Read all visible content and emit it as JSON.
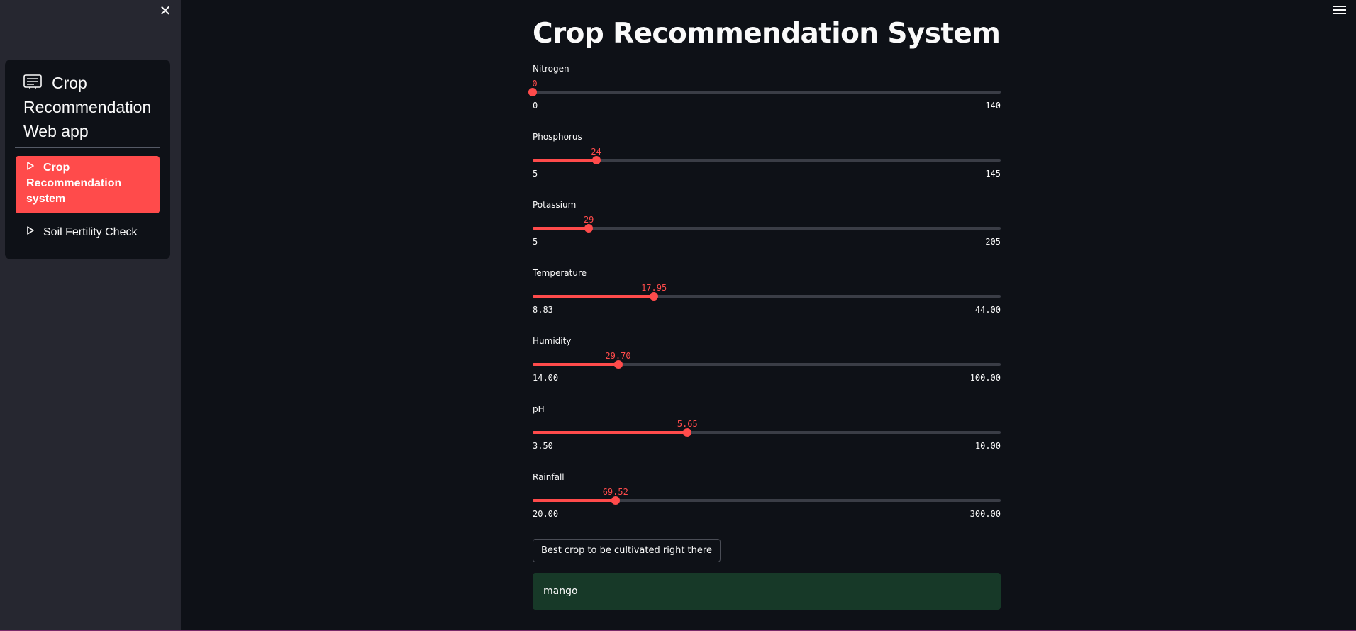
{
  "sidebar": {
    "menu_title": "Crop Recommendation Web app",
    "items": [
      {
        "label": "Crop Recommendation system",
        "active": true
      },
      {
        "label": "Soil Fertility Check",
        "active": false
      }
    ]
  },
  "main": {
    "title": "Crop Recommendation System",
    "sliders": [
      {
        "label": "Nitrogen",
        "value": "0",
        "min": "0",
        "max": "140",
        "fraction": 0.0
      },
      {
        "label": "Phosphorus",
        "value": "24",
        "min": "5",
        "max": "145",
        "fraction": 0.1357
      },
      {
        "label": "Potassium",
        "value": "29",
        "min": "5",
        "max": "205",
        "fraction": 0.12
      },
      {
        "label": "Temperature",
        "value": "17.95",
        "min": "8.83",
        "max": "44.00",
        "fraction": 0.2593
      },
      {
        "label": "Humidity",
        "value": "29.70",
        "min": "14.00",
        "max": "100.00",
        "fraction": 0.1826
      },
      {
        "label": "pH",
        "value": "5.65",
        "min": "3.50",
        "max": "10.00",
        "fraction": 0.3308
      },
      {
        "label": "Rainfall",
        "value": "69.52",
        "min": "20.00",
        "max": "300.00",
        "fraction": 0.1769
      }
    ],
    "button_label": "Best crop to be cultivated right there",
    "result": "mango"
  },
  "colors": {
    "accent": "#ff4b4b",
    "background": "#0e1117",
    "sidebar": "#262730",
    "success_bg": "#173928"
  }
}
